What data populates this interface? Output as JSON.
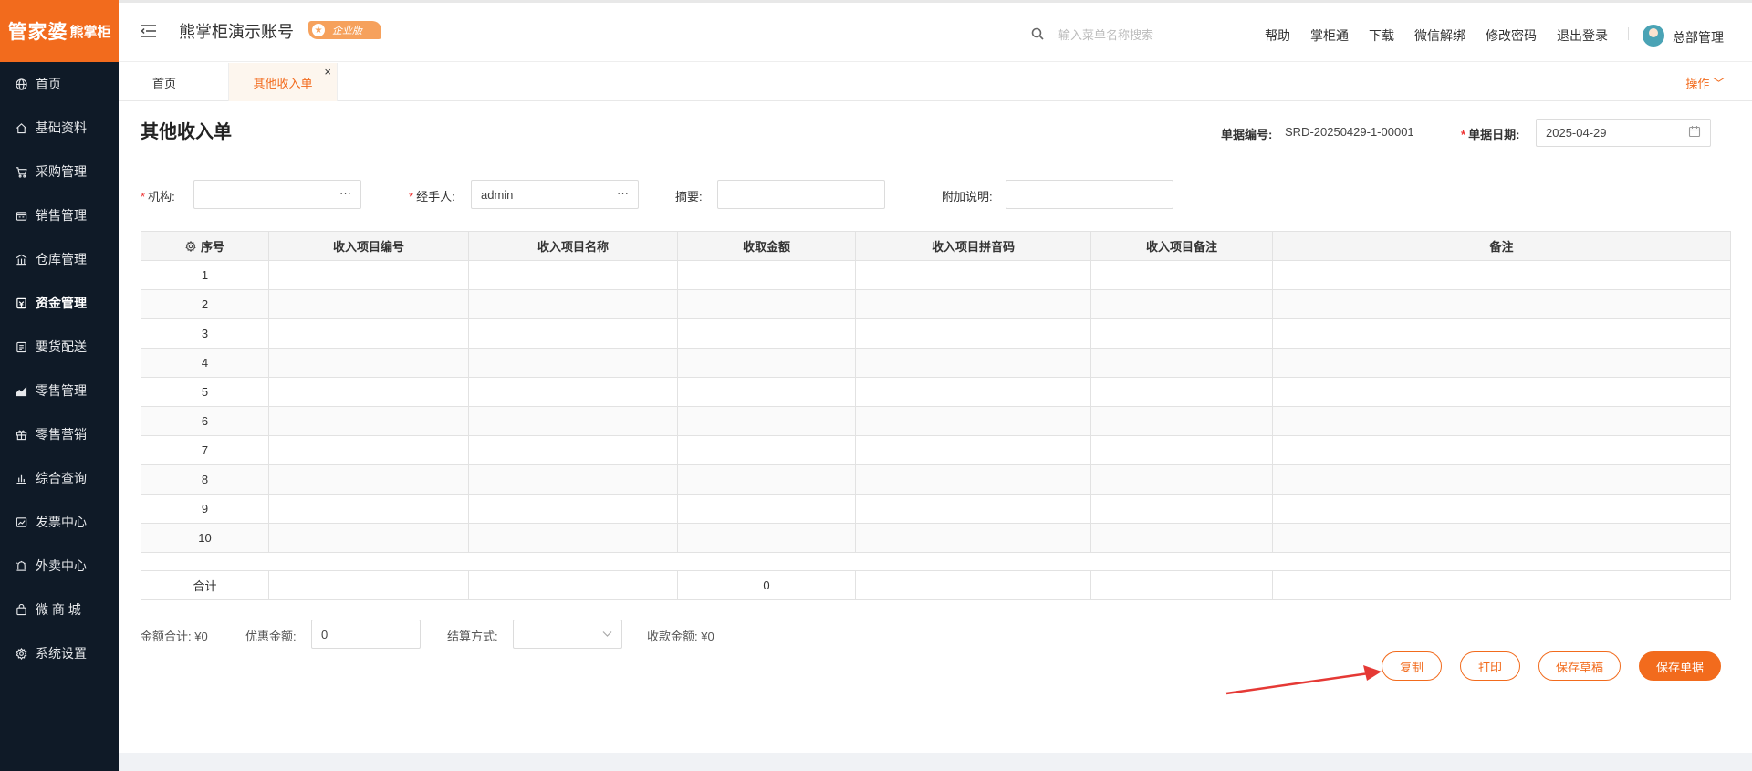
{
  "logo": {
    "main": "管家婆",
    "sub": "熊掌柜"
  },
  "sidebar": {
    "items": [
      {
        "label": "首页",
        "icon": "globe-icon"
      },
      {
        "label": "基础资料",
        "icon": "home-icon"
      },
      {
        "label": "采购管理",
        "icon": "cart-icon"
      },
      {
        "label": "销售管理",
        "icon": "register-icon"
      },
      {
        "label": "仓库管理",
        "icon": "warehouse-icon"
      },
      {
        "label": "资金管理",
        "icon": "wallet-icon"
      },
      {
        "label": "要货配送",
        "icon": "document-icon"
      },
      {
        "label": "零售管理",
        "icon": "area-chart-icon"
      },
      {
        "label": "零售营销",
        "icon": "gift-icon"
      },
      {
        "label": "综合查询",
        "icon": "bar-chart-icon"
      },
      {
        "label": "发票中心",
        "icon": "invoice-icon"
      },
      {
        "label": "外卖中心",
        "icon": "delivery-icon"
      },
      {
        "label": "微 商 城",
        "icon": "shop-bag-icon"
      },
      {
        "label": "系统设置",
        "icon": "gear-icon"
      }
    ],
    "active_index": 5
  },
  "header": {
    "account_name": "熊掌柜演示账号",
    "edition_badge": "企业版",
    "search_placeholder": "输入菜单名称搜索",
    "links": [
      "帮助",
      "掌柜通",
      "下载",
      "微信解绑",
      "修改密码",
      "退出登录"
    ],
    "username": "总部管理"
  },
  "tabs": {
    "home": "首页",
    "current": "其他收入单",
    "close_glyph": "×",
    "operations": "操作"
  },
  "form": {
    "title": "其他收入单",
    "doc_no_label": "单据编号:",
    "doc_no_value": "SRD-20250429-1-00001",
    "date_label": "单据日期:",
    "date_value": "2025-04-29",
    "org_label": "机构:",
    "org_value": "",
    "handler_label": "经手人:",
    "handler_value": "admin",
    "summary_label": "摘要:",
    "summary_value": "",
    "note_label": "附加说明:",
    "note_value": "",
    "ellipsis": "···"
  },
  "table": {
    "headers": [
      "序号",
      "收入项目编号",
      "收入项目名称",
      "收取金额",
      "收入项目拼音码",
      "收入项目备注",
      "备注"
    ],
    "rows": [
      "1",
      "2",
      "3",
      "4",
      "5",
      "6",
      "7",
      "8",
      "9",
      "10"
    ],
    "total_label": "合计",
    "total_amount": "0"
  },
  "summary": {
    "amount_total": "金额合计: ¥0",
    "discount_label": "优惠金额:",
    "discount_value": "0",
    "settle_label": "结算方式:",
    "settle_value": "",
    "received": "收款金额: ¥0"
  },
  "buttons": {
    "copy": "复制",
    "print": "打印",
    "save_draft": "保存草稿",
    "save": "保存单据"
  },
  "colors": {
    "accent": "#f26b1d",
    "sidebar_bg": "#0f1a27",
    "annotation_arrow": "#e53935"
  }
}
